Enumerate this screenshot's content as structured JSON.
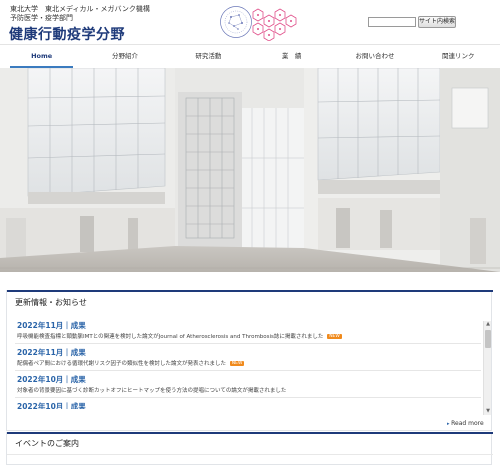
{
  "header": {
    "org_line1": "東北大学　東北メディカル・メガバンク機構",
    "org_line2": "予防医学・疫学部門",
    "site_title": "健康行動疫学分野"
  },
  "search": {
    "placeholder": "",
    "button_label": "サイト内検索"
  },
  "nav": {
    "items": [
      {
        "label": "Home",
        "active": true
      },
      {
        "label": "分野紹介",
        "active": false
      },
      {
        "label": "研究活動",
        "active": false
      },
      {
        "label": "業　績",
        "active": false
      },
      {
        "label": "お問い合わせ",
        "active": false
      },
      {
        "label": "関連リンク",
        "active": false
      }
    ]
  },
  "news": {
    "heading": "更新情報・お知らせ",
    "items": [
      {
        "date": "2022年11月｜成果",
        "text": "呼吸機能検査指標と頸動脈IMTとの関連を検討した論文がJournal of Atherosclerosis and Thrombosis誌に掲載されました",
        "badge": "NEW"
      },
      {
        "date": "2022年11月｜成果",
        "text": "配偶者ペア間における循環代謝リスク因子の類似性を検討した論文が発表されました",
        "badge": "NEW"
      },
      {
        "date": "2022年10月｜成果",
        "text": "対象者の背景要因に基づく診断カットオフにヒートマップを使う方法の提唱についての論文が掲載されました",
        "badge": ""
      },
      {
        "date": "2022年10月｜成果",
        "text": "",
        "badge": ""
      }
    ],
    "read_more": "Read more"
  },
  "events": {
    "heading": "イベントのご案内"
  },
  "colors": {
    "accent": "#1e3a7a",
    "link": "#2a64a8",
    "badge": "#f08a1c",
    "logo_pink": "#e0508a",
    "logo_blue": "#6b78b8"
  }
}
